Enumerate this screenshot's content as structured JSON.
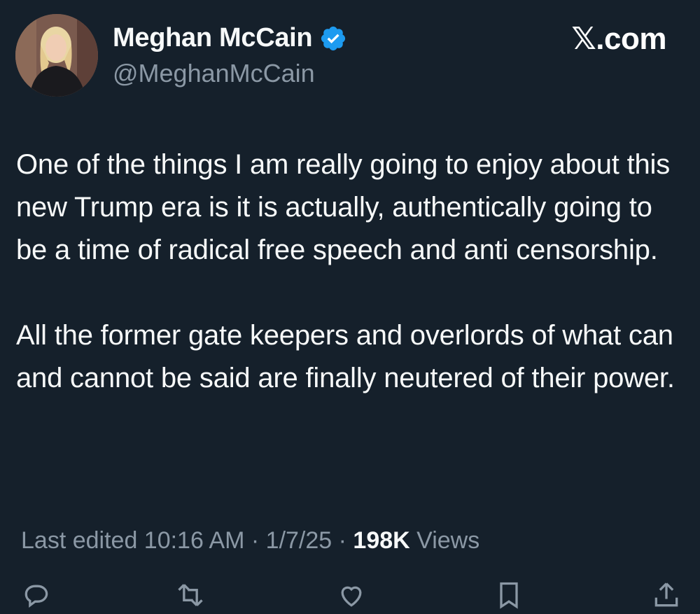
{
  "author": {
    "display_name": "Meghan McCain",
    "handle": "@MeghanMcCain",
    "verified": true,
    "avatar_icon": "profile-photo"
  },
  "brand": {
    "label": "𝕏.com"
  },
  "tweet": {
    "paragraphs": [
      "One of the things I am really going to enjoy about this new Trump era is it is actually, authentically going to be a time of radical free speech and anti censorship.",
      "All the former gate keepers and overlords of what can and cannot be said are finally neutered of their power."
    ]
  },
  "meta": {
    "edited_prefix": "Last edited ",
    "time": "10:16 AM",
    "separator1": " · ",
    "date": "1/7/25",
    "separator2": " · ",
    "views_count": "198K",
    "views_label": " Views"
  },
  "actions": [
    "reply-icon",
    "retweet-icon",
    "like-icon",
    "bookmark-icon",
    "share-icon"
  ],
  "colors": {
    "background": "#15202b",
    "text_primary": "#f7f9f9",
    "text_secondary": "#8b98a5",
    "verified_blue": "#1d9bf0"
  }
}
